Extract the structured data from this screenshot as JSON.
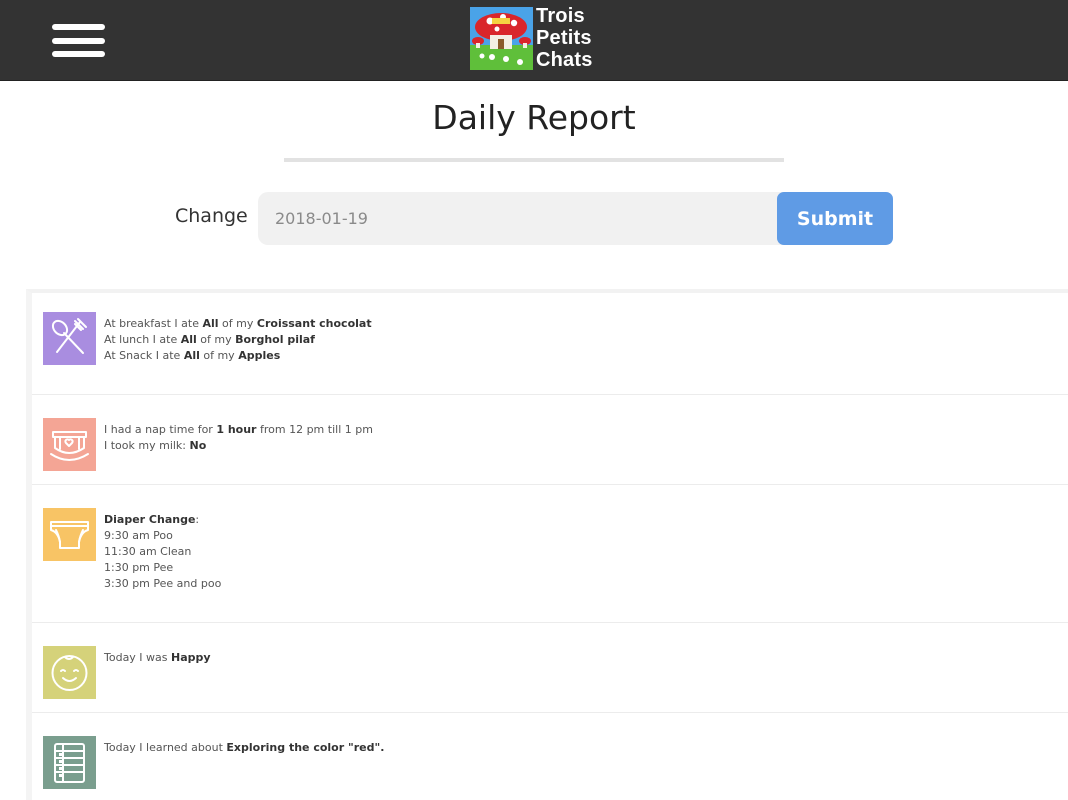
{
  "header": {
    "menu_icon": "hamburger-menu-icon",
    "logo": {
      "line1": "Trois",
      "line2": "Petits",
      "line3": "Chats"
    }
  },
  "page": {
    "title": "Daily Report"
  },
  "date_form": {
    "label": "Change",
    "date_value": "2018-01-19",
    "submit_label": "Submit"
  },
  "entries": {
    "meals": {
      "icon": "utensils-icon",
      "color": "#a98de0",
      "breakfast": {
        "prefix": "At breakfast I ate ",
        "amount": "All",
        "mid": " of my ",
        "food": "Croissant chocolat"
      },
      "lunch": {
        "prefix": "At lunch I ate ",
        "amount": "All",
        "mid": " of my ",
        "food": "Borghol pilaf"
      },
      "snack": {
        "prefix": "At Snack I ate ",
        "amount": "All",
        "mid": " of my ",
        "food": "Apples"
      }
    },
    "nap": {
      "icon": "cradle-icon",
      "color": "#f4a595",
      "nap_prefix": "I had a nap time for ",
      "nap_duration": "1 hour",
      "nap_suffix": " from 12 pm till 1 pm",
      "milk_prefix": "I took my milk: ",
      "milk_value": "No"
    },
    "diaper": {
      "icon": "diaper-icon",
      "color": "#f8c465",
      "heading": "Diaper Change",
      "heading_suffix": ":",
      "changes": [
        "9:30 am Poo",
        "11:30 am Clean",
        "1:30 pm Pee",
        "3:30 pm Pee and poo"
      ]
    },
    "mood": {
      "icon": "baby-face-icon",
      "color": "#d5d27a",
      "prefix": "Today I was ",
      "value": "Happy"
    },
    "learning": {
      "icon": "abacus-icon",
      "color": "#7a9e8e",
      "prefix": "Today I learned about ",
      "topic": "Exploring the color \"red\".",
      "suffix": ""
    }
  }
}
